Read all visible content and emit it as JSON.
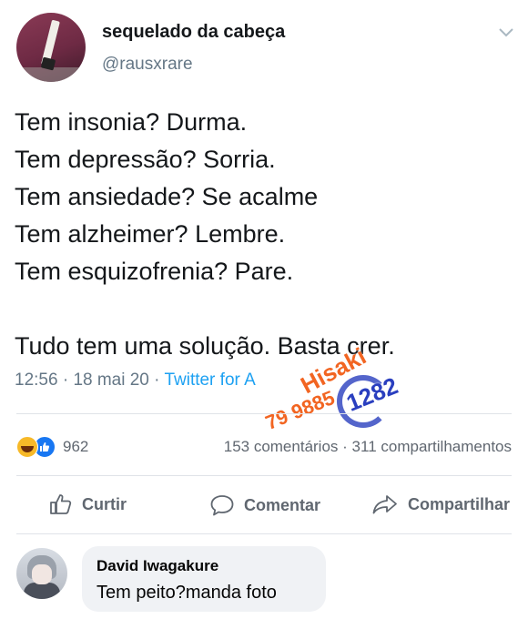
{
  "tweet": {
    "display_name": "sequelado da cabeça",
    "handle": "@rausxrare",
    "lines": [
      "Tem insonia? Durma.",
      "Tem depressão? Sorria.",
      "Tem ansiedade? Se acalme",
      "Tem alzheimer? Lembre.",
      "Tem esquizofrenia? Pare.",
      "",
      "Tudo tem uma solução. Basta crer."
    ],
    "time": "12:56",
    "date": "18 mai 20",
    "source": "Twitter for A"
  },
  "watermark": {
    "line1": "Hisaki",
    "line2": "1282",
    "line3": "79 9885"
  },
  "facebook": {
    "reaction_count": "962",
    "comments": "153 comentários",
    "shares": "311 compartilhamentos",
    "actions": {
      "like": "Curtir",
      "comment": "Comentar",
      "share": "Compartilhar"
    },
    "comment": {
      "author": "David Iwagakure",
      "text": "Tem peito?manda foto"
    }
  },
  "colors": {
    "link": "#1da1f2",
    "muted": "#657786",
    "fb_blue": "#1877f2",
    "watermark_orange": "#f26522",
    "watermark_blue": "#2a3fbf"
  }
}
